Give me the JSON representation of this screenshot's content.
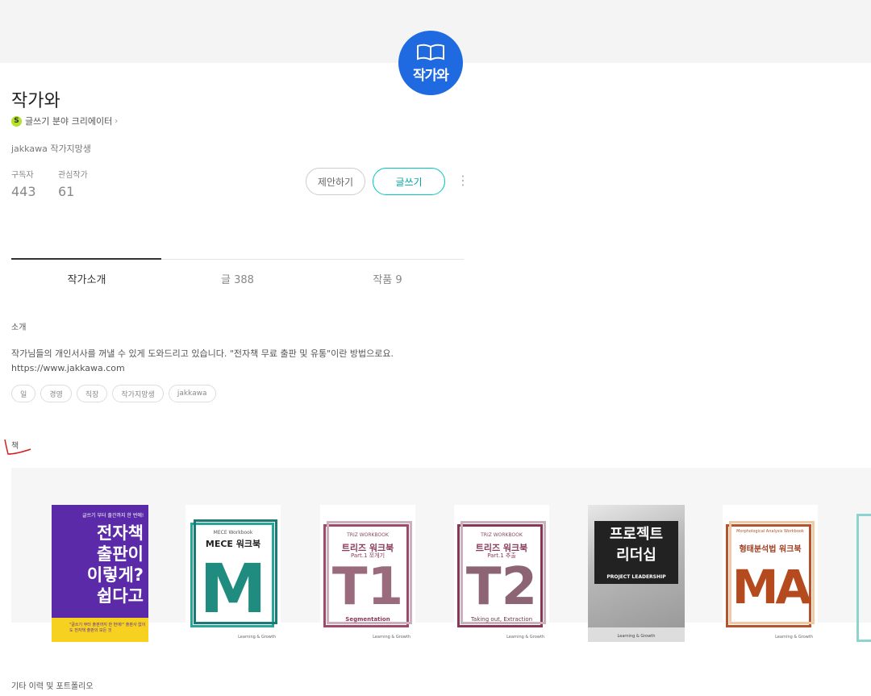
{
  "logo": {
    "text": "작가와",
    "icon": "open-book-icon",
    "color": "#1f6ae0"
  },
  "profile": {
    "name": "작가와",
    "creator_badge": "S",
    "creator_label": "글쓰기 분야 크리에이터",
    "creator_arrow": "›",
    "job": "jakkawa 작가지망생"
  },
  "stats": {
    "subscribers_label": "구독자",
    "subscribers_value": "443",
    "following_label": "관심작가",
    "following_value": "61"
  },
  "buttons": {
    "suggest": "제안하기",
    "write": "글쓰기",
    "more": "⋮"
  },
  "tabs": [
    {
      "label": "작가소개",
      "active": true
    },
    {
      "label": "글 388",
      "active": false
    },
    {
      "label": "작품 9",
      "active": false
    }
  ],
  "intro": {
    "section_title": "소개",
    "text": "작가님들의 개인서사를 꺼낼 수 있게 도와드리고 있습니다. \"전자책 무료 출판 및 유통\"이란 방법으로요.",
    "link": "https://www.jakkawa.com"
  },
  "keywords": [
    "일",
    "경영",
    "직장",
    "작가지망생",
    "jakkawa"
  ],
  "books_section": {
    "title": "책",
    "books": [
      {
        "top": "글쓰기 부터 출간까지 한 번에!",
        "title_lines": [
          "전자책",
          "출판이",
          "이렇게?",
          "쉽다고"
        ],
        "bottom": "\"글쓰기 부터 출판까지 한 번에!\" 출판사 없이도 전자책 출판의 모든 것"
      },
      {
        "sub": "MECE Workbook",
        "title": "MECE 워크북",
        "big": "M",
        "foot": "",
        "logo": "Learning & Growth"
      },
      {
        "sub": "TRIZ WORKBOOK",
        "title": "트리즈 워크북",
        "title2": "Part.1 쪼개기",
        "big": "T1",
        "foot": "Segmentation",
        "logo": "Learning & Growth"
      },
      {
        "sub": "TRIZ WORKBOOK",
        "title": "트리즈 워크북",
        "title2": "Part.1 추출",
        "big": "T2",
        "foot": "Taking out, Extraction",
        "logo": "Learning & Growth"
      },
      {
        "title_lines": [
          "프로젝트",
          "리더십"
        ],
        "sub": "PROJECT LEADERSHIP",
        "logo": "Learning & Growth"
      },
      {
        "sub": "Morphological Analysis Workbook",
        "title": "형태분석법 워크북",
        "big": "MA",
        "foot": "",
        "logo": "Learning & Growth"
      }
    ]
  },
  "other_section": {
    "title": "기타 이력 및 포트폴리오"
  },
  "colors": {
    "accent_teal": "#00aaa6",
    "creator_badge": "#b4e12a"
  }
}
